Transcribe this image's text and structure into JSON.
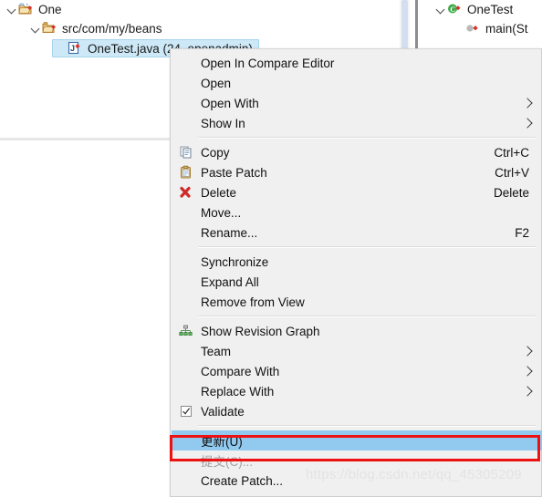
{
  "tree": {
    "items": [
      {
        "label": "One",
        "icon": "project-icon",
        "indent": 0,
        "expanded": true,
        "selected": false
      },
      {
        "label": "src/com/my/beans",
        "icon": "package-folder-icon",
        "indent": 1,
        "expanded": true,
        "selected": false
      },
      {
        "label": "OneTest.java (24, openadmin)",
        "icon": "java-file-icon",
        "indent": 2,
        "expanded": false,
        "selected": true
      }
    ]
  },
  "right_panel": {
    "items": [
      {
        "label": "OneTest",
        "icon": "class-icon",
        "indent": 0,
        "expanded": true
      },
      {
        "label": "main(St",
        "icon": "method-icon",
        "indent": 1,
        "expanded": false
      }
    ]
  },
  "context_menu": {
    "items": [
      {
        "label": "Open In Compare Editor",
        "icon": "",
        "accel": "",
        "submenu": false,
        "state": "normal"
      },
      {
        "label": "Open",
        "icon": "",
        "accel": "",
        "submenu": false,
        "state": "normal"
      },
      {
        "label": "Open With",
        "icon": "",
        "accel": "",
        "submenu": true,
        "state": "normal"
      },
      {
        "label": "Show In",
        "icon": "",
        "accel": "",
        "submenu": true,
        "state": "normal"
      },
      {
        "separator": true
      },
      {
        "label": "Copy",
        "icon": "copy-icon",
        "accel": "Ctrl+C",
        "submenu": false,
        "state": "normal"
      },
      {
        "label": "Paste Patch",
        "icon": "paste-icon",
        "accel": "Ctrl+V",
        "submenu": false,
        "state": "normal"
      },
      {
        "label": "Delete",
        "icon": "delete-icon",
        "accel": "Delete",
        "submenu": false,
        "state": "normal"
      },
      {
        "label": "Move...",
        "icon": "",
        "accel": "",
        "submenu": false,
        "state": "normal"
      },
      {
        "label": "Rename...",
        "icon": "",
        "accel": "F2",
        "submenu": false,
        "state": "normal"
      },
      {
        "separator": true
      },
      {
        "label": "Synchronize",
        "icon": "",
        "accel": "",
        "submenu": false,
        "state": "normal"
      },
      {
        "label": "Expand All",
        "icon": "",
        "accel": "",
        "submenu": false,
        "state": "normal"
      },
      {
        "label": "Remove from View",
        "icon": "",
        "accel": "",
        "submenu": false,
        "state": "normal"
      },
      {
        "separator": true
      },
      {
        "label": "Show Revision Graph",
        "icon": "revision-graph-icon",
        "accel": "",
        "submenu": false,
        "state": "normal"
      },
      {
        "label": "Team",
        "icon": "",
        "accel": "",
        "submenu": true,
        "state": "normal"
      },
      {
        "label": "Compare With",
        "icon": "",
        "accel": "",
        "submenu": true,
        "state": "normal"
      },
      {
        "label": "Replace With",
        "icon": "",
        "accel": "",
        "submenu": true,
        "state": "normal"
      },
      {
        "label": "Validate",
        "icon": "checkbox-checked-icon",
        "accel": "",
        "submenu": false,
        "state": "normal"
      },
      {
        "separator": true
      },
      {
        "label": "更新(U)",
        "icon": "",
        "accel": "",
        "submenu": false,
        "state": "highlighted"
      },
      {
        "label": "提交(C)...",
        "icon": "",
        "accel": "",
        "submenu": false,
        "state": "disabled"
      },
      {
        "label": "Create Patch...",
        "icon": "",
        "accel": "",
        "submenu": false,
        "state": "normal"
      }
    ]
  },
  "annotation": {
    "highlight_border_color": "#ee1111",
    "highlight_row_color": "#91c9ef"
  },
  "watermark": {
    "text": "https://blog.csdn.net/qq_45305209"
  }
}
